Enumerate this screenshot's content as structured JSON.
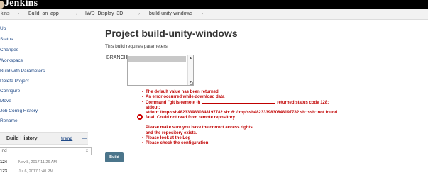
{
  "header": {
    "logo_text": "Jenkins"
  },
  "breadcrumb": [
    "kins",
    "Build_an_app",
    "IWD_Display_3D",
    "build-unity-windows"
  ],
  "sidebar": {
    "items": [
      {
        "label": "Up",
        "icon": "arrow-up-icon"
      },
      {
        "label": "Status",
        "icon": "status-icon"
      },
      {
        "label": "Changes",
        "icon": "notepad-icon"
      },
      {
        "label": "Workspace",
        "icon": "folder-icon"
      },
      {
        "label": "Build with Parameters",
        "icon": "clock-icon"
      },
      {
        "label": "Delete Project",
        "icon": "delete-icon"
      },
      {
        "label": "Configure",
        "icon": "gear-icon"
      },
      {
        "label": "Move",
        "icon": "move-icon"
      },
      {
        "label": "Job Config History",
        "icon": "history-icon"
      },
      {
        "label": "Rename",
        "icon": "rename-icon"
      }
    ]
  },
  "build_history": {
    "title": "Build History",
    "trend_label": "trend",
    "trend_icon": "—",
    "filter_value": "ind",
    "filter_clear": "x",
    "builds": [
      {
        "number": "124",
        "date": "Nov 8, 2017 11:26 AM"
      },
      {
        "number": "123",
        "date": "Jul 6, 2017 1:40 PM"
      }
    ]
  },
  "main": {
    "title": "Project build-unity-windows",
    "intro": "This build requires parameters:",
    "param_label": "BRANCH",
    "errors": [
      {
        "text": "The default value has been returned",
        "bullet": true
      },
      {
        "text": "An error occurred while download data",
        "bullet": true
      },
      {
        "text": "Command \"git ls-remote -h",
        "suffix": "returned status code 128:",
        "bullet": true,
        "field": true
      },
      {
        "text": "stdout:",
        "bullet": false
      },
      {
        "text": "stderr: /tmp/ssh4823339830848197782.sh: 6: /tmp/ssh4823339830848197782.sh: ssh: not found",
        "bullet": false
      },
      {
        "text": "fatal: Could not read from remote repository.",
        "bullet": false
      },
      {
        "text": "",
        "bullet": false
      },
      {
        "text": "Please make sure you have the correct access rights",
        "bullet": false
      },
      {
        "text": "and the repository exists.",
        "bullet": false
      },
      {
        "text": "Please look at the Log",
        "bullet": true
      },
      {
        "text": "Please check the configuration",
        "bullet": true
      }
    ],
    "build_button": "Build"
  },
  "colors": {
    "header_bg": "#000000",
    "error": "#c00000",
    "link": "#204a87",
    "button": "#4b758b"
  }
}
